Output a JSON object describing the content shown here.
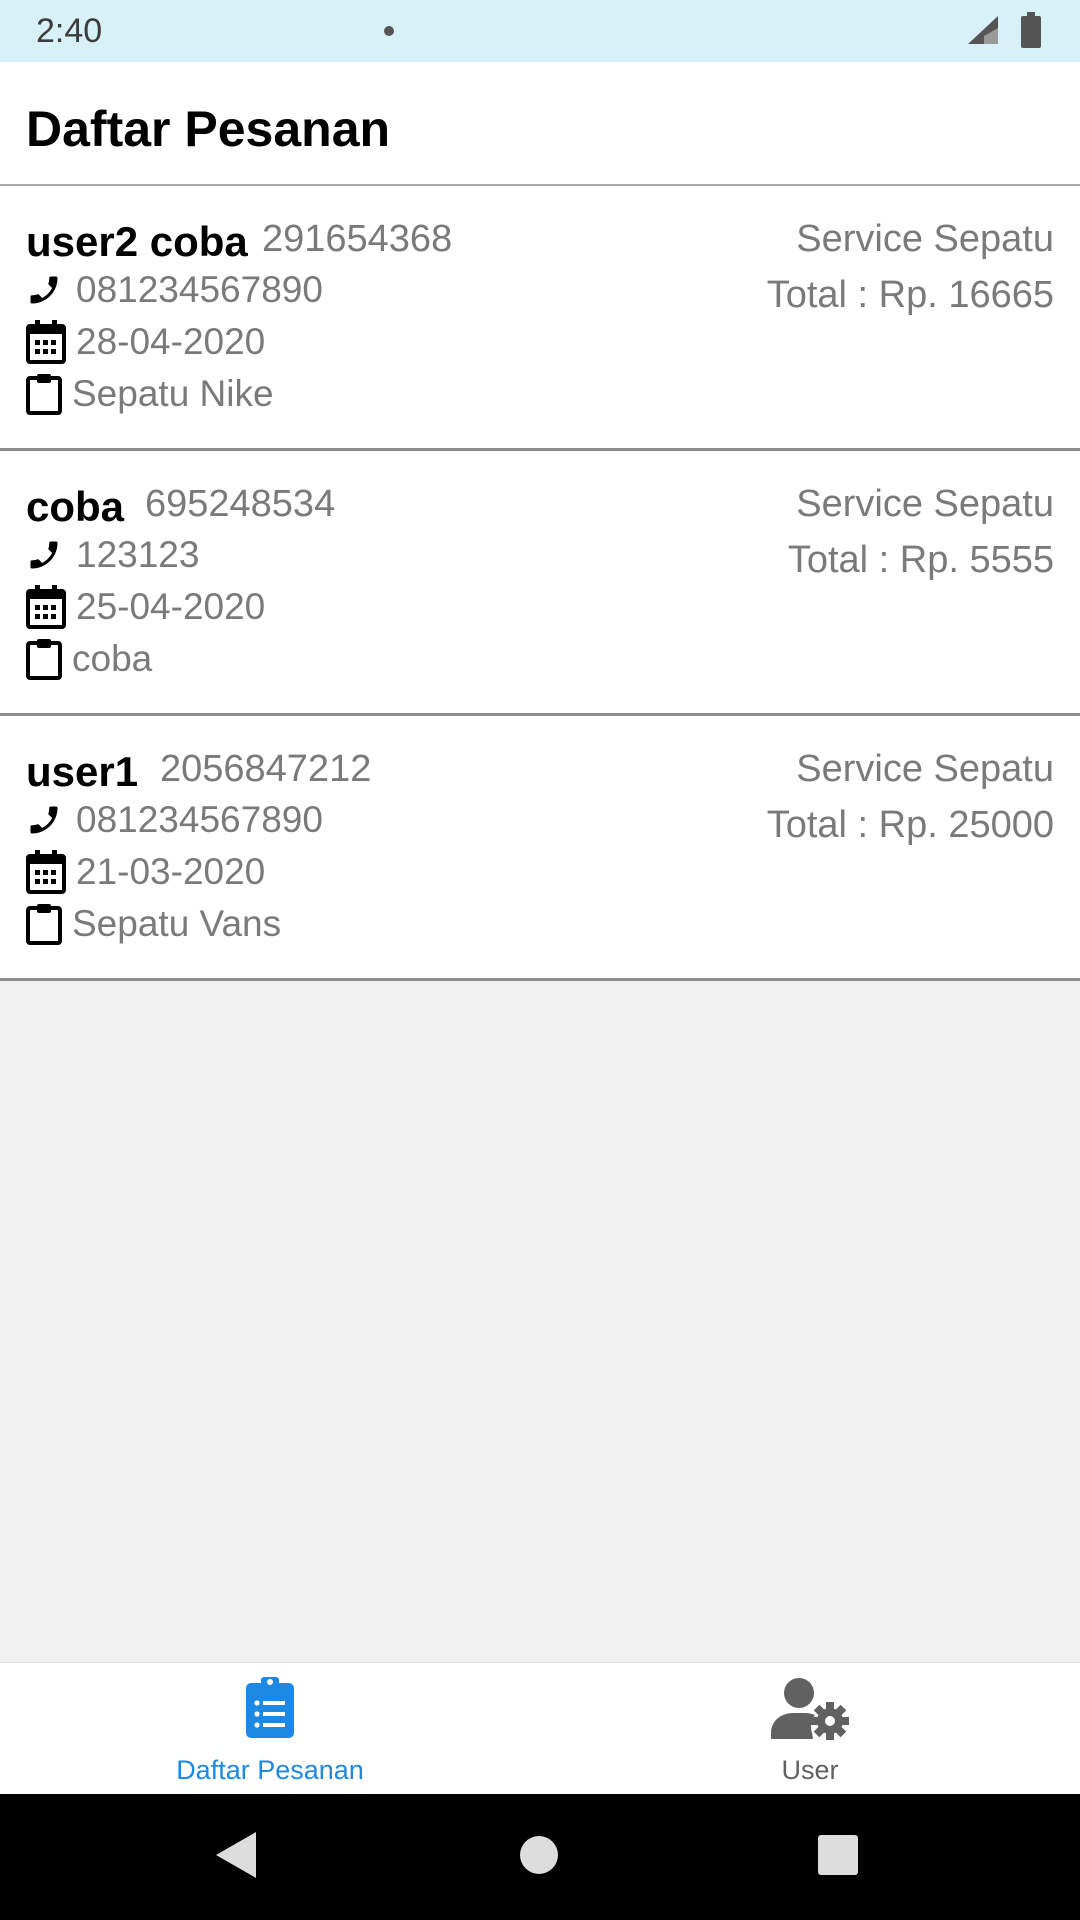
{
  "status_bar": {
    "time": "2:40"
  },
  "page": {
    "title": "Daftar Pesanan"
  },
  "orders": [
    {
      "name": "user2 coba",
      "id": "291654368",
      "phone": "081234567890",
      "date": "28-04-2020",
      "item": "Sepatu Nike",
      "service": "Service Sepatu",
      "total": "Total : Rp. 16665"
    },
    {
      "name": "coba",
      "id": "695248534",
      "phone": "123123",
      "date": "25-04-2020",
      "item": "coba",
      "service": "Service Sepatu",
      "total": "Total : Rp. 5555"
    },
    {
      "name": "user1",
      "id": "2056847212",
      "phone": "081234567890",
      "date": "21-03-2020",
      "item": "Sepatu Vans",
      "service": "Service Sepatu",
      "total": "Total : Rp. 25000"
    }
  ],
  "bottom_nav": {
    "items": [
      {
        "label": "Daftar Pesanan",
        "icon": "clipboard-list-icon",
        "active": true
      },
      {
        "label": "User",
        "icon": "user-cog-icon",
        "active": false
      }
    ]
  },
  "colors": {
    "accent": "#1e88e5",
    "status_bar": "#d8f0f7"
  }
}
